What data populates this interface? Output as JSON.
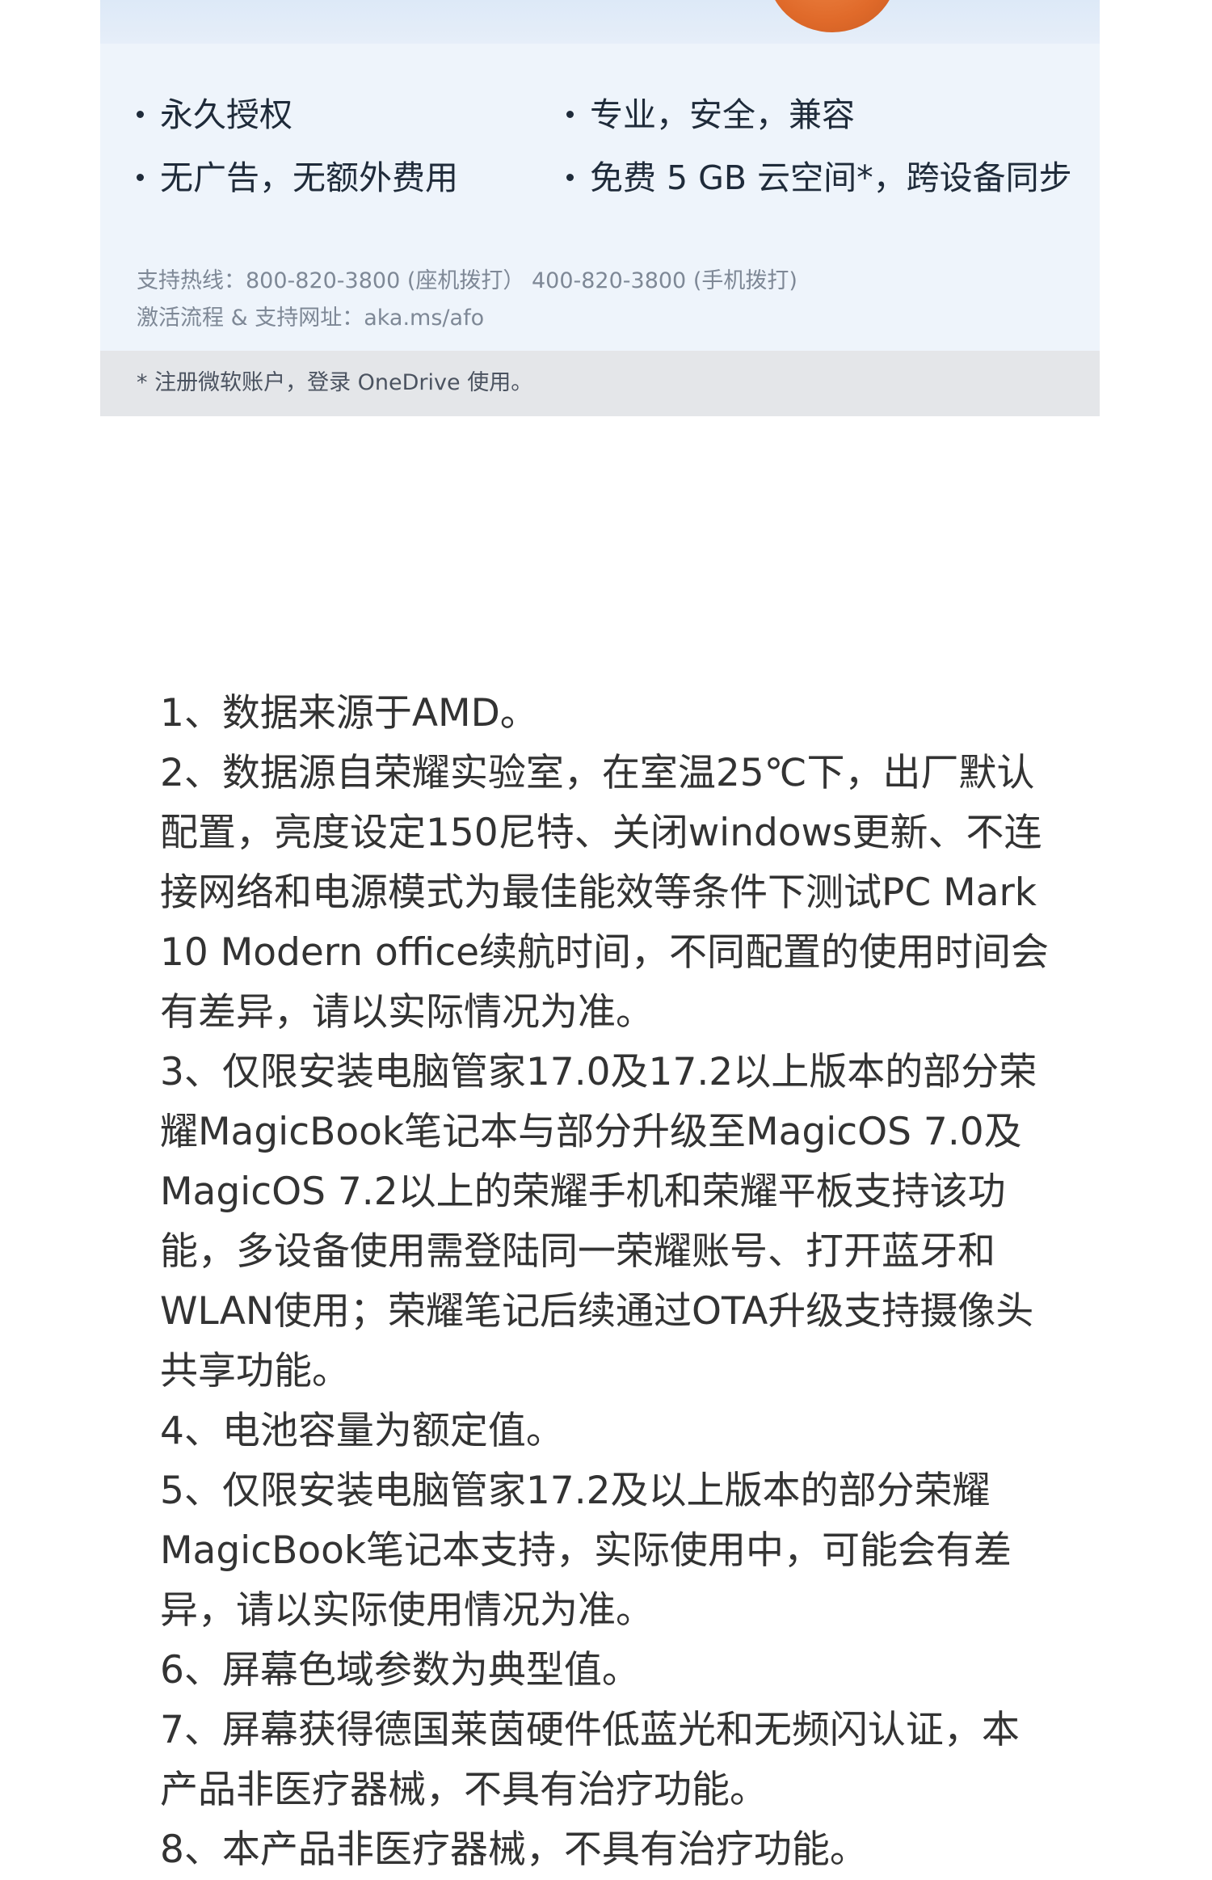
{
  "card": {
    "features": [
      "永久授权",
      "专业，安全，兼容",
      "无广告，无额外费用",
      "免费 5 GB 云空间*，跨设备同步"
    ],
    "support_hotline": "支持热线：800-820-3800 (座机拨打）  400-820-3800 (手机拨打)",
    "support_site": "激活流程 & 支持网址：aka.ms/afo",
    "footnote": "* 注册微软账户，登录 OneDrive 使用。",
    "colors": {
      "card_background": "#eef4fb",
      "footer_background": "#e4e6e9",
      "accent_orange": "#e06a2a"
    }
  },
  "notes": [
    "1、数据来源于AMD。",
    "2、数据源自荣耀实验室，在室温25℃下，出厂默认配置，亮度设定150尼特、关闭windows更新、不连接网络和电源模式为最佳能效等条件下测试PC Mark 10 Modern office续航时间，不同配置的使用时间会有差异，请以实际情况为准。",
    "3、仅限安装电脑管家17.0及17.2以上版本的部分荣耀MagicBook笔记本与部分升级至MagicOS 7.0及MagicOS 7.2以上的荣耀手机和荣耀平板支持该功能，多设备使用需登陆同一荣耀账号、打开蓝牙和WLAN使用；荣耀笔记后续通过OTA升级支持摄像头共享功能。",
    "4、电池容量为额定值。",
    "5、仅限安装电脑管家17.2及以上版本的部分荣耀MagicBook笔记本支持，实际使用中，可能会有差异，请以实际使用情况为准。",
    "6、屏幕色域参数为典型值。",
    "7、屏幕获得德国莱茵硬件低蓝光和无频闪认证，本产品非医疗器械，不具有治疗功能。",
    "8、本产品非医疗器械，不具有治疗功能。"
  ]
}
